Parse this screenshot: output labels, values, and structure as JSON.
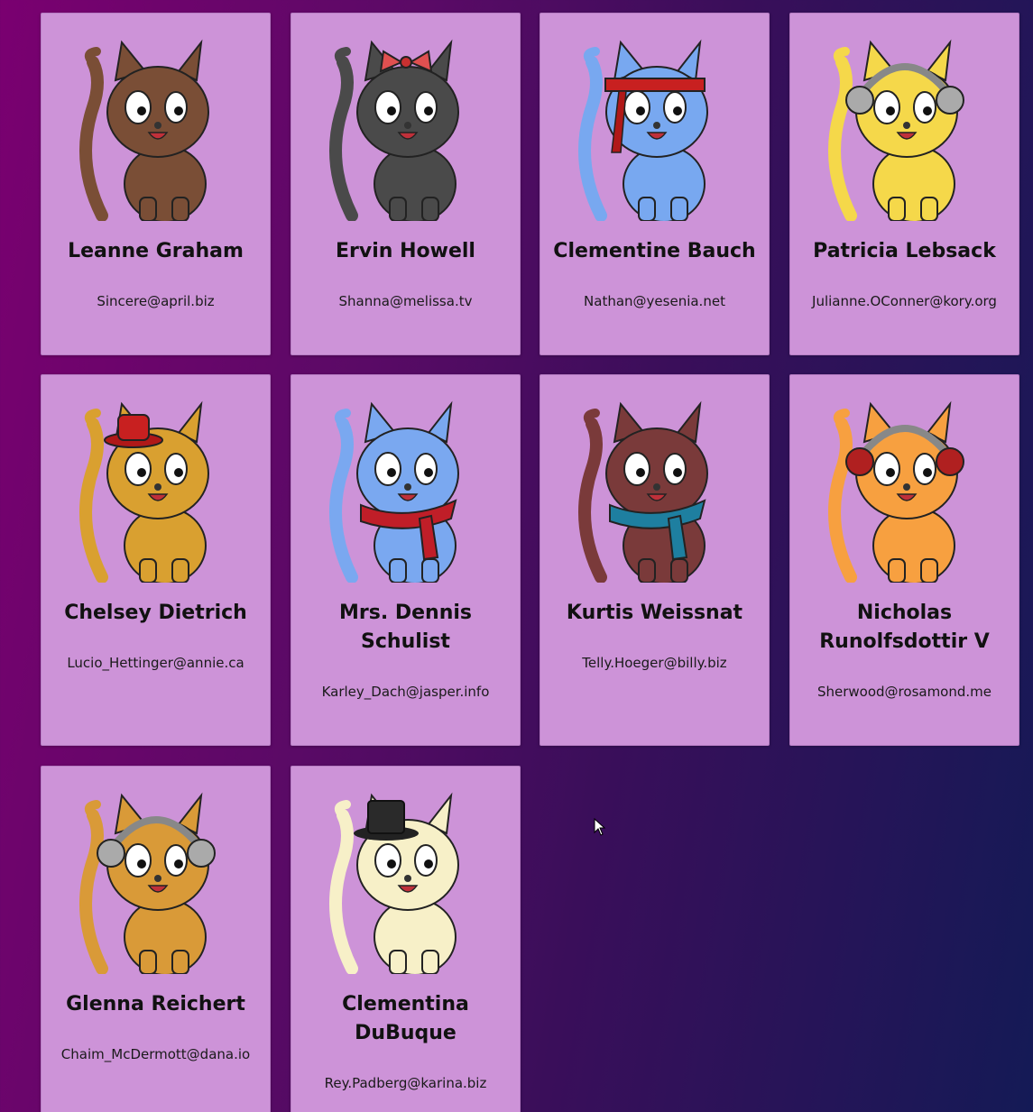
{
  "users": [
    {
      "name": "Leanne Graham",
      "email": "Sincere@april.biz",
      "color": "#7a4e36",
      "accessory": "none",
      "icon": "cat-robot-avatar-icon"
    },
    {
      "name": "Ervin Howell",
      "email": "Shanna@melissa.tv",
      "color": "#4a4a4a",
      "accessory": "bow",
      "icon": "cat-robot-avatar-icon"
    },
    {
      "name": "Clementine Bauch",
      "email": "Nathan@yesenia.net",
      "color": "#78a8f0",
      "accessory": "headband",
      "icon": "cat-robot-avatar-icon"
    },
    {
      "name": "Patricia Lebsack",
      "email": "Julianne.OConner@kory.org",
      "color": "#f5d84a",
      "accessory": "headphones",
      "icon": "cat-robot-avatar-icon"
    },
    {
      "name": "Chelsey Dietrich",
      "email": "Lucio_Hettinger@annie.ca",
      "color": "#d9a030",
      "accessory": "hat",
      "icon": "cat-robot-avatar-icon"
    },
    {
      "name": "Mrs. Dennis Schulist",
      "email": "Karley_Dach@jasper.info",
      "color": "#7aa8f0",
      "accessory": "scarf-red",
      "icon": "cat-robot-avatar-icon"
    },
    {
      "name": "Kurtis Weissnat",
      "email": "Telly.Hoeger@billy.biz",
      "color": "#7a3a3a",
      "accessory": "scarf-blue",
      "icon": "cat-robot-avatar-icon"
    },
    {
      "name": "Nicholas Runolfsdottir V",
      "email": "Sherwood@rosamond.me",
      "color": "#f7a040",
      "accessory": "headphones-red",
      "icon": "cat-robot-avatar-icon"
    },
    {
      "name": "Glenna Reichert",
      "email": "Chaim_McDermott@dana.io",
      "color": "#d99a38",
      "accessory": "headphones",
      "icon": "cat-robot-avatar-icon"
    },
    {
      "name": "Clementina DuBuque",
      "email": "Rey.Padberg@karina.biz",
      "color": "#f7f0c8",
      "accessory": "tophat",
      "icon": "cat-robot-avatar-icon"
    }
  ]
}
